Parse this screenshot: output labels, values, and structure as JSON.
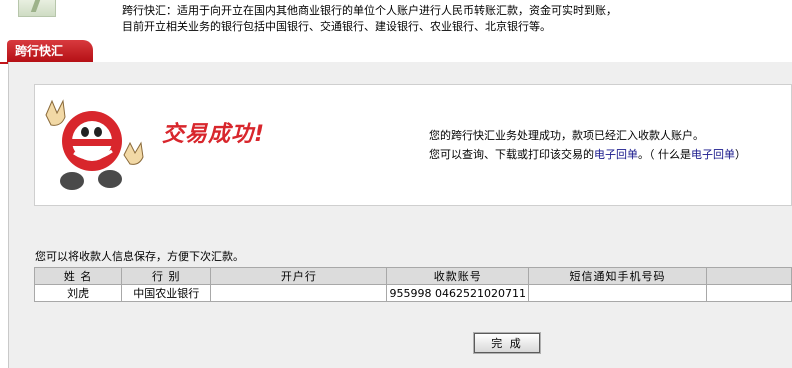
{
  "header": {
    "line1": "跨行快汇：适用于向开立在国内其他商业银行的单位个人账户进行人民币转账汇款，资金可实时到账，",
    "line2": "目前开立相关业务的银行包括中国银行、交通银行、建设银行、农业银行、北京银行等。"
  },
  "tab": {
    "label": "跨行快汇"
  },
  "result": {
    "title": "交易成功!",
    "message1": "您的跨行快汇业务处理成功，款项已经汇入收款人账户。",
    "message2_prefix": "您可以查询、下载或打印该交易的",
    "link_receipt": "电子回单",
    "message2_middle": "。（ 什么是",
    "link_what": "电子回单",
    "message2_suffix": "）"
  },
  "save_hint": "您可以将收款人信息保存，方便下次汇款。",
  "table": {
    "headers": [
      "姓 名",
      "行 别",
      "开户行",
      "收款账号",
      "短信通知手机号码",
      ""
    ],
    "rows": [
      [
        "刘虎",
        "中国农业银行",
        "",
        "955998 0462521020711",
        "",
        ""
      ]
    ]
  },
  "done_button": "完 成",
  "colors": {
    "accent": "#c1151a",
    "title_red": "#d8262c",
    "panel_bg": "#efefef"
  }
}
